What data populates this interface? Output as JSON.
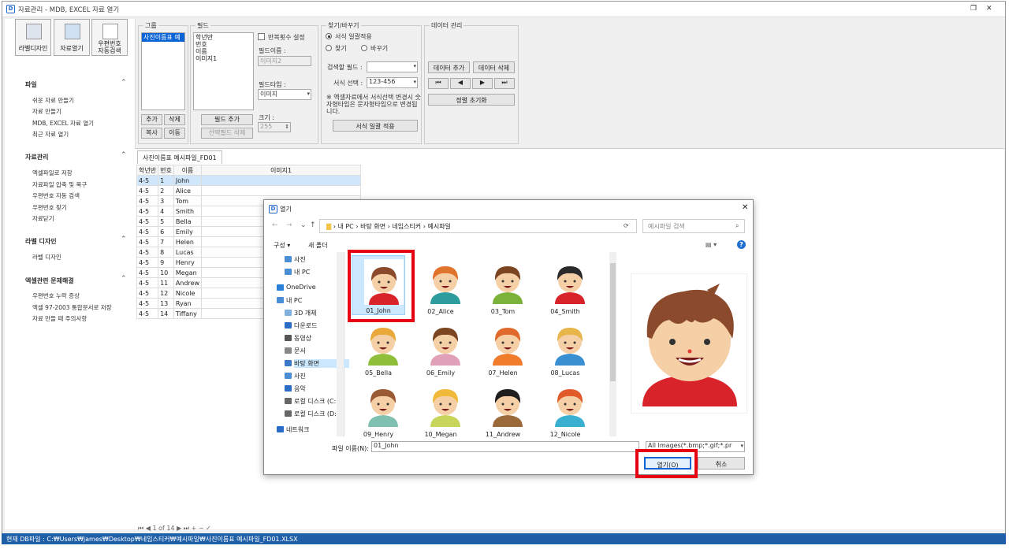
{
  "app": {
    "title": "자료관리 - MDB, EXCEL 자료 열기"
  },
  "toolbar": {
    "label_design": "라벨디자인",
    "open_data": "자료열기",
    "postal": "우편번호\n자동검색"
  },
  "sidebar": {
    "sections": [
      {
        "title": "파일",
        "items": [
          "쉬운 자료 만들기",
          "자료 만들기",
          "MDB, EXCEL 자료 열기",
          "최근 자료 열기"
        ]
      },
      {
        "title": "자료관리",
        "items": [
          "엑셀파일로 저장",
          "자료파일 압축 및 복구",
          "우편번호 자동 검색",
          "우편번호 찾기",
          "자료닫기"
        ]
      },
      {
        "title": "라벨 디자인",
        "items": [
          "라벨 디자인"
        ]
      },
      {
        "title": "엑셀관련 문제해결",
        "items": [
          "우편번호 누락 증상",
          "엑셀 97-2003 통합문서로 저장",
          "자료 만들 때 주의사항"
        ]
      }
    ]
  },
  "group_panel": {
    "label": "그룹",
    "item": "사진이름표 예",
    "add": "추가",
    "delete": "삭제",
    "copy": "복사",
    "move": "이동"
  },
  "field_panel": {
    "label": "필드",
    "items": [
      "학년반",
      "번호",
      "이름",
      "이미지1"
    ],
    "repeat_label": "반복횟수 설정",
    "name_label": "필드이름 :",
    "name_value": "이미지2",
    "type_label": "필드타입 :",
    "type_value": "이미지",
    "size_label": "크기 :",
    "size_value": "255",
    "add_field": "필드 추가",
    "del_selected": "선택필드 삭제"
  },
  "find_panel": {
    "label": "찾기/바꾸기",
    "opt_bulk": "서식 일괄적용",
    "opt_find": "찾기",
    "opt_replace": "바꾸기",
    "field_label": "검색할 필드 :",
    "format_label": "서식 선택 :",
    "format_value": "123-456",
    "note": "※ 엑셀자료에서 서식선택 변경시 숫자형타입은 문자형타입으로 변경됩니다.",
    "apply": "서식 일괄 적용"
  },
  "data_panel": {
    "label": "데이터 관리",
    "add": "데이터 추가",
    "delete": "데이터 삭제",
    "reset": "정렬 초기화"
  },
  "tab": {
    "label": "사진이름표 예시파일_FD01"
  },
  "grid": {
    "headers": [
      "학년반",
      "번호",
      "이름",
      "이미지1"
    ],
    "rows": [
      [
        "4-5",
        "1",
        "John"
      ],
      [
        "4-5",
        "2",
        "Alice"
      ],
      [
        "4-5",
        "3",
        "Tom"
      ],
      [
        "4-5",
        "4",
        "Smith"
      ],
      [
        "4-5",
        "5",
        "Bella"
      ],
      [
        "4-5",
        "6",
        "Emily"
      ],
      [
        "4-5",
        "7",
        "Helen"
      ],
      [
        "4-5",
        "8",
        "Lucas"
      ],
      [
        "4-5",
        "9",
        "Henry"
      ],
      [
        "4-5",
        "10",
        "Megan"
      ],
      [
        "4-5",
        "11",
        "Andrew"
      ],
      [
        "4-5",
        "12",
        "Nicole"
      ],
      [
        "4-5",
        "13",
        "Ryan"
      ],
      [
        "4-5",
        "14",
        "Tiffany"
      ]
    ]
  },
  "pager": {
    "text": "1 of 14"
  },
  "status": {
    "text": "현재 DB파일 : C:₩Users₩james₩Desktop₩네임스티커₩예시파일₩사진이름표 예시파일_FD01.XLSX"
  },
  "dialog": {
    "title": "열기",
    "breadcrumb": [
      "내 PC",
      "바탕 화면",
      "네임스티커",
      "예시파일"
    ],
    "search_placeholder": "예시파일 검색",
    "organize": "구성 ▾",
    "new_folder": "새 폴더",
    "tree": [
      "사진",
      "내 PC",
      "OneDrive",
      "내 PC",
      "3D 개체",
      "다운로드",
      "동영상",
      "문서",
      "바탕 화면",
      "사진",
      "음악",
      "로컬 디스크 (C:)",
      "로컬 디스크 (D:)",
      "네트워크"
    ],
    "files": [
      "01_John",
      "02_Alice",
      "03_Tom",
      "04_Smith",
      "05_Bella",
      "06_Emily",
      "07_Helen",
      "08_Lucas",
      "09_Henry",
      "10_Megan",
      "11_Andrew",
      "12_Nicole"
    ],
    "filename_label": "파일 이름(N):",
    "filename_value": "01_John",
    "filter_value": "All Images(*.bmp;*.gif;*.pr",
    "open": "열기(O)",
    "cancel": "취소"
  },
  "colors": {
    "accent": "#1f5fa8",
    "highlight": "#e60012",
    "selection": "#cce8ff"
  }
}
